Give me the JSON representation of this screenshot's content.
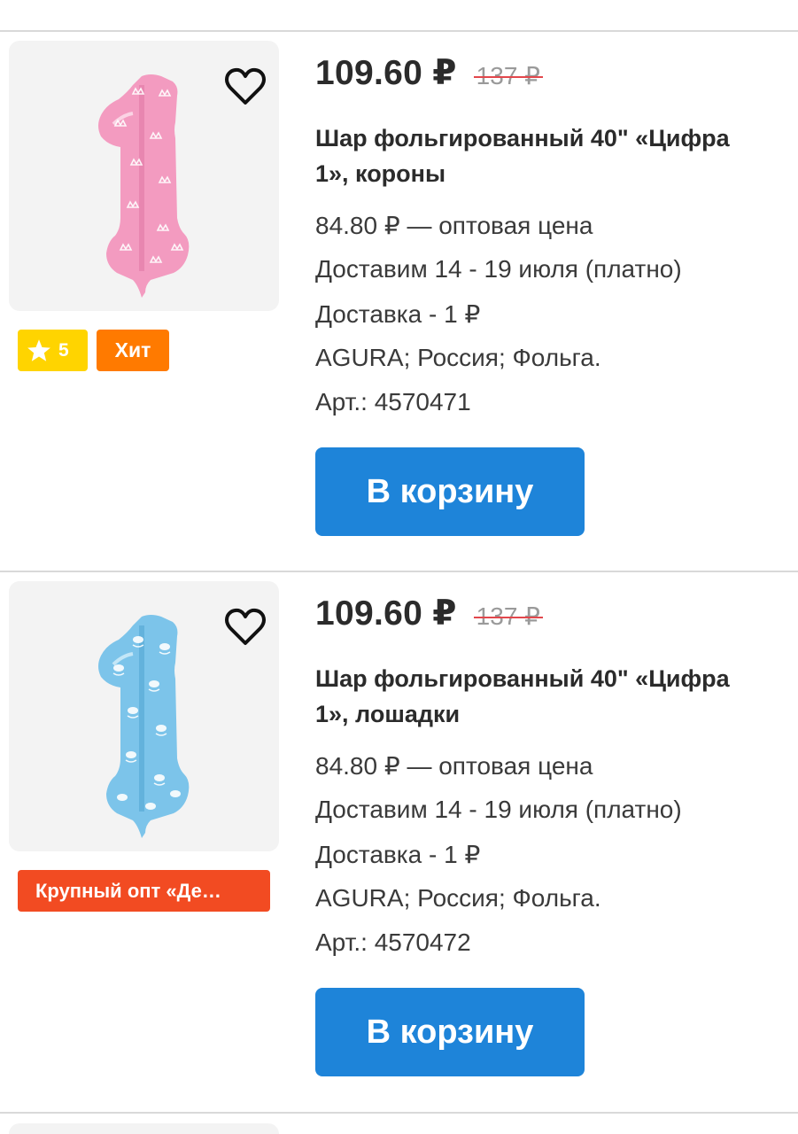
{
  "products": [
    {
      "price": "109.60 ₽",
      "old_price": "137 ₽",
      "title": "Шар фольгированный 40\" «Цифра 1», короны",
      "wholesale": "84.80 ₽ — оптовая цена",
      "delivery_dates": "Доставим 14 - 19 июля (платно)",
      "delivery_cost": "Доставка - 1 ₽",
      "manufacturer": "AGURA; Россия; Фольга.",
      "article": "Арт.: 4570471",
      "cart_label": "В корзину",
      "rating": "5",
      "hit_label": "Хит",
      "balloon_color": "#f39bc0",
      "pattern": "crowns"
    },
    {
      "price": "109.60 ₽",
      "old_price": "137 ₽",
      "title": "Шар фольгированный 40\" «Цифра 1», лошадки",
      "wholesale": "84.80 ₽ — оптовая цена",
      "delivery_dates": "Доставим 14 - 19 июля (платно)",
      "delivery_cost": "Доставка - 1 ₽",
      "manufacturer": "AGURA; Россия; Фольга.",
      "article": "Арт.: 4570472",
      "cart_label": "В корзину",
      "promo_label": "Крупный опт «Де…",
      "balloon_color": "#7cc4ea",
      "pattern": "rocking-horses"
    }
  ],
  "colors": {
    "accent_button": "#1e84d9",
    "rating_badge": "#ffd400",
    "hit_badge": "#ff7a00",
    "promo_badge": "#f24b22",
    "strike": "#e2474c"
  }
}
